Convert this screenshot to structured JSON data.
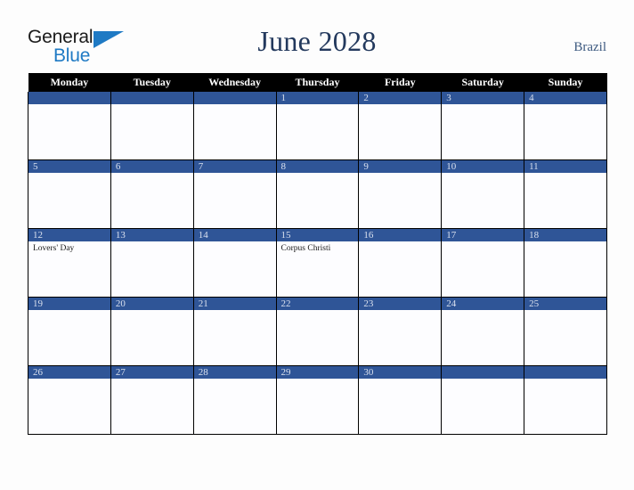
{
  "logo": {
    "word_one": "General",
    "word_two": "Blue",
    "triangle": "triangle-shape"
  },
  "header": {
    "title": "June 2028",
    "country": "Brazil"
  },
  "calendar": {
    "weekday_headers": [
      "Monday",
      "Tuesday",
      "Wednesday",
      "Thursday",
      "Friday",
      "Saturday",
      "Sunday"
    ],
    "accent_color": "#2f5597",
    "header_color": "#000000",
    "title_color": "#23395d",
    "weeks": [
      [
        {
          "date": "",
          "events": []
        },
        {
          "date": "",
          "events": []
        },
        {
          "date": "",
          "events": []
        },
        {
          "date": "1",
          "events": []
        },
        {
          "date": "2",
          "events": []
        },
        {
          "date": "3",
          "events": []
        },
        {
          "date": "4",
          "events": []
        }
      ],
      [
        {
          "date": "5",
          "events": []
        },
        {
          "date": "6",
          "events": []
        },
        {
          "date": "7",
          "events": []
        },
        {
          "date": "8",
          "events": []
        },
        {
          "date": "9",
          "events": []
        },
        {
          "date": "10",
          "events": []
        },
        {
          "date": "11",
          "events": []
        }
      ],
      [
        {
          "date": "12",
          "events": [
            "Lovers' Day"
          ]
        },
        {
          "date": "13",
          "events": []
        },
        {
          "date": "14",
          "events": []
        },
        {
          "date": "15",
          "events": [
            "Corpus Christi"
          ]
        },
        {
          "date": "16",
          "events": []
        },
        {
          "date": "17",
          "events": []
        },
        {
          "date": "18",
          "events": []
        }
      ],
      [
        {
          "date": "19",
          "events": []
        },
        {
          "date": "20",
          "events": []
        },
        {
          "date": "21",
          "events": []
        },
        {
          "date": "22",
          "events": []
        },
        {
          "date": "23",
          "events": []
        },
        {
          "date": "24",
          "events": []
        },
        {
          "date": "25",
          "events": []
        }
      ],
      [
        {
          "date": "26",
          "events": []
        },
        {
          "date": "27",
          "events": []
        },
        {
          "date": "28",
          "events": []
        },
        {
          "date": "29",
          "events": []
        },
        {
          "date": "30",
          "events": []
        },
        {
          "date": "",
          "events": []
        },
        {
          "date": "",
          "events": []
        }
      ]
    ]
  }
}
